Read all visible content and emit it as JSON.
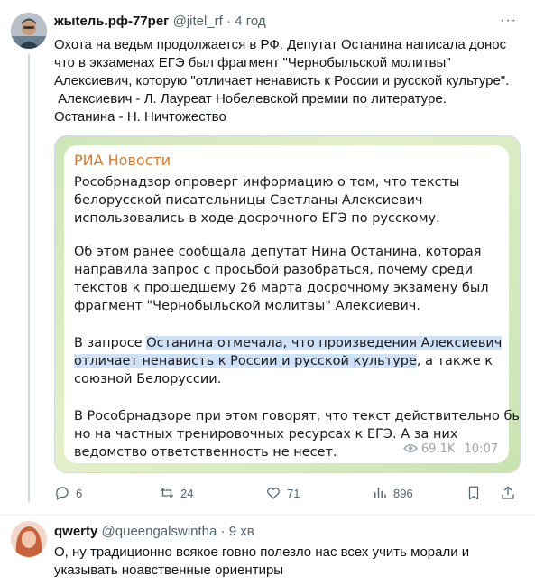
{
  "tweet1": {
    "author_name": "жыtель.рф-77рег",
    "handle": "@jitel_rf",
    "separator": "·",
    "time": "4 год",
    "text_lines": [
      "Охота на ведьм продолжается в РФ. Депутат Останина написала донос",
      "что в экзаменах ЕГЭ был фрагмент \"Чернобыльской молитвы\"",
      "Алексиевич, которую \"отличает ненависть к России и русской культуре\".",
      " Алексиевич - Л. Лауреат Нобелевской премии по литературе.",
      "Останина - Н. Ничтожество"
    ],
    "media": {
      "source": "РИА Новости",
      "para1": [
        "Рособрнадзор опроверг информацию о том, что тексты",
        "белорусской писательницы Светланы Алексиевич",
        "использовались в ходе досрочного ЕГЭ по русскому."
      ],
      "para2": [
        "Об этом ранее сообщала депутат Нина Останина, которая",
        "направила запрос с просьбой разобраться, почему среди",
        "текстов к прошедшему 26 марта досрочному экзамену был",
        "фрагмент \"Чернобыльской молитвы\" Алексиевич."
      ],
      "para3": {
        "l1_a": "В запросе ",
        "l1_hl": "Останина отмечала, что произведения Алексиевич",
        "l2_hl": "отличает ненависть к России и русской культуре",
        "l2_b": ", а также к",
        "l3": "союзной Белоруссии."
      },
      "para4": [
        "В Рособрнадзоре при этом говорят, что текст действительно был,",
        "но на частных тренировочных ресурсах к ЕГЭ. А за них",
        "ведомство ответственность не несет."
      ],
      "views": "69.1K",
      "msg_time": "10:07"
    },
    "actions": {
      "replies": "6",
      "retweets": "24",
      "likes": "71",
      "views": "896"
    }
  },
  "tweet2": {
    "author_name": "qwerty",
    "handle": "@queengalswintha",
    "separator": "·",
    "time": "9 хв",
    "text_lines": [
      "О, ну традиционно всякое говно полезло нас всех учить морали и",
      "указывать ноавственные ориентиры"
    ]
  },
  "colors": {
    "accent_orange": "#d97a2b",
    "highlight": "#cfe1f7",
    "muted": "#536471"
  }
}
